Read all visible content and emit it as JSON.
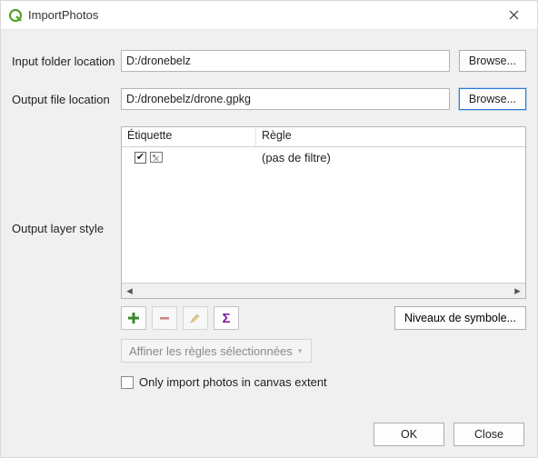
{
  "window": {
    "title": "ImportPhotos"
  },
  "inputFolder": {
    "label": "Input folder location",
    "value": "D:/dronebelz",
    "browse": "Browse..."
  },
  "outputFile": {
    "label": "Output file location",
    "value": "D:/dronebelz/drone.gpkg",
    "browse": "Browse..."
  },
  "style": {
    "label": "Output layer style",
    "columns": {
      "etiquette": "Étiquette",
      "regle": "Règle"
    },
    "rows": [
      {
        "checked": true,
        "rule": "(pas de filtre)"
      }
    ],
    "levels": "Niveaux de symbole...",
    "refine": "Affiner les règles sélectionnées"
  },
  "onlyExtent": {
    "label": "Only import photos in canvas extent",
    "checked": false
  },
  "buttons": {
    "ok": "OK",
    "close": "Close"
  },
  "glyphs": {
    "check": "✔",
    "sigma": "Σ",
    "tri_left": "◂",
    "tri_right": "▸",
    "tri_down": "▾"
  }
}
